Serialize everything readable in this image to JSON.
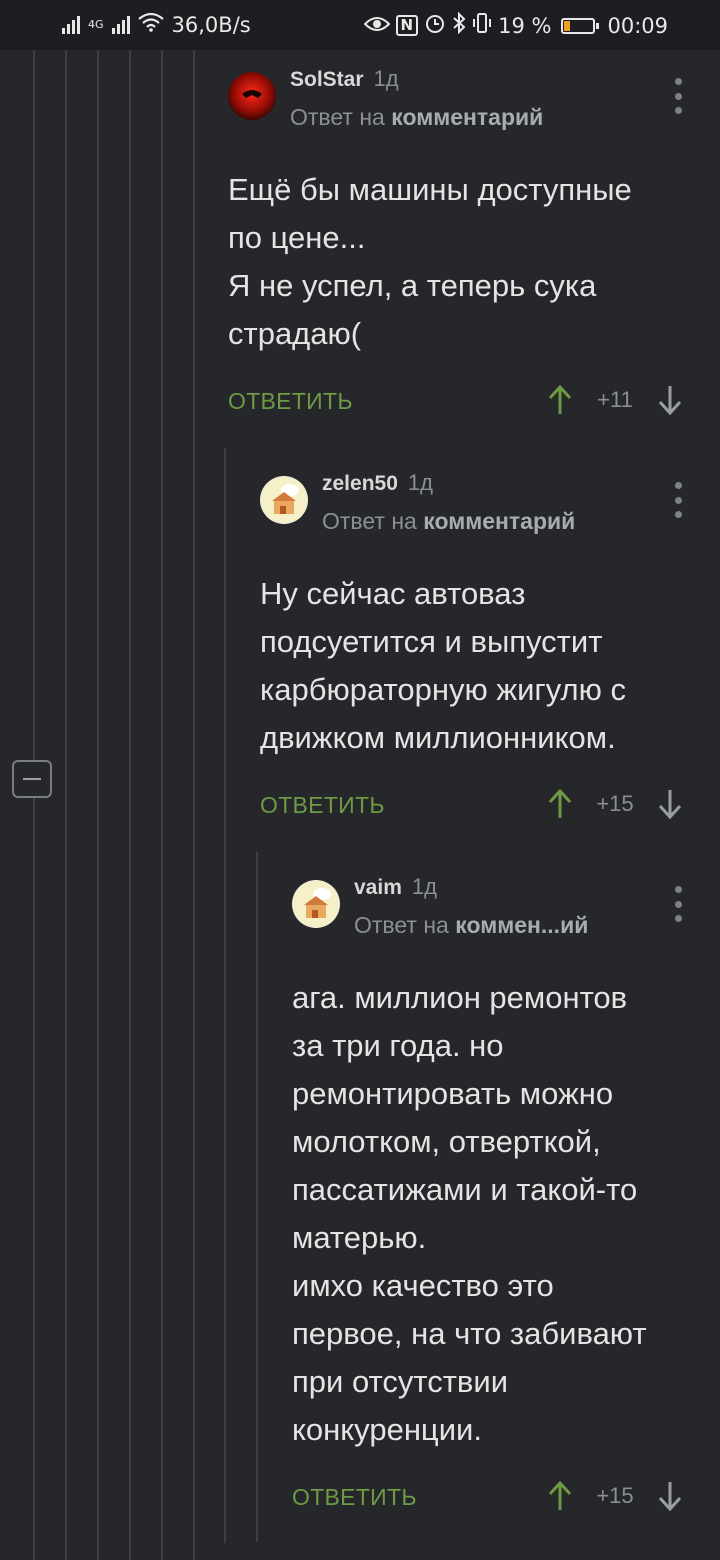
{
  "status_bar": {
    "network_type": "4G",
    "speed": "36,0B/s",
    "nfc": "N",
    "battery_percent": "19 %",
    "battery_level": 0.19,
    "time": "00:09"
  },
  "colors": {
    "background": "#25272b",
    "accent_green": "#6e9a44",
    "muted_text": "#8b8e93"
  },
  "comments": [
    {
      "author": "SolStar",
      "time": "1д",
      "reply_prefix": "Ответ на",
      "reply_target": "комментарий",
      "text": "Ещё бы машины доступные\nпо цене...\nЯ не успел, а теперь сука\nстрадаю(",
      "reply_label": "ОТВЕТИТЬ",
      "score": "+11"
    },
    {
      "author": "zelen50",
      "time": "1д",
      "reply_prefix": "Ответ на",
      "reply_target": "комментарий",
      "text": "Ну сейчас автоваз\nподсуетится и выпустит\nкарбюраторную жигулю с\nдвижком миллионником.",
      "reply_label": "ОТВЕТИТЬ",
      "score": "+15"
    },
    {
      "author": "vaim",
      "time": "1д",
      "reply_prefix": "Ответ на",
      "reply_target": "коммен...ий",
      "text": "ага. миллион ремонтов\nза три года. но\nремонтировать можно\nмолотком, отверткой,\nпассатижами и такой-то\nматерью.\nимхо качество это\nпервое, на что забивают\nпри отсутствии\nконкуренции.",
      "reply_label": "ОТВЕТИТЬ",
      "score": "+15"
    }
  ]
}
